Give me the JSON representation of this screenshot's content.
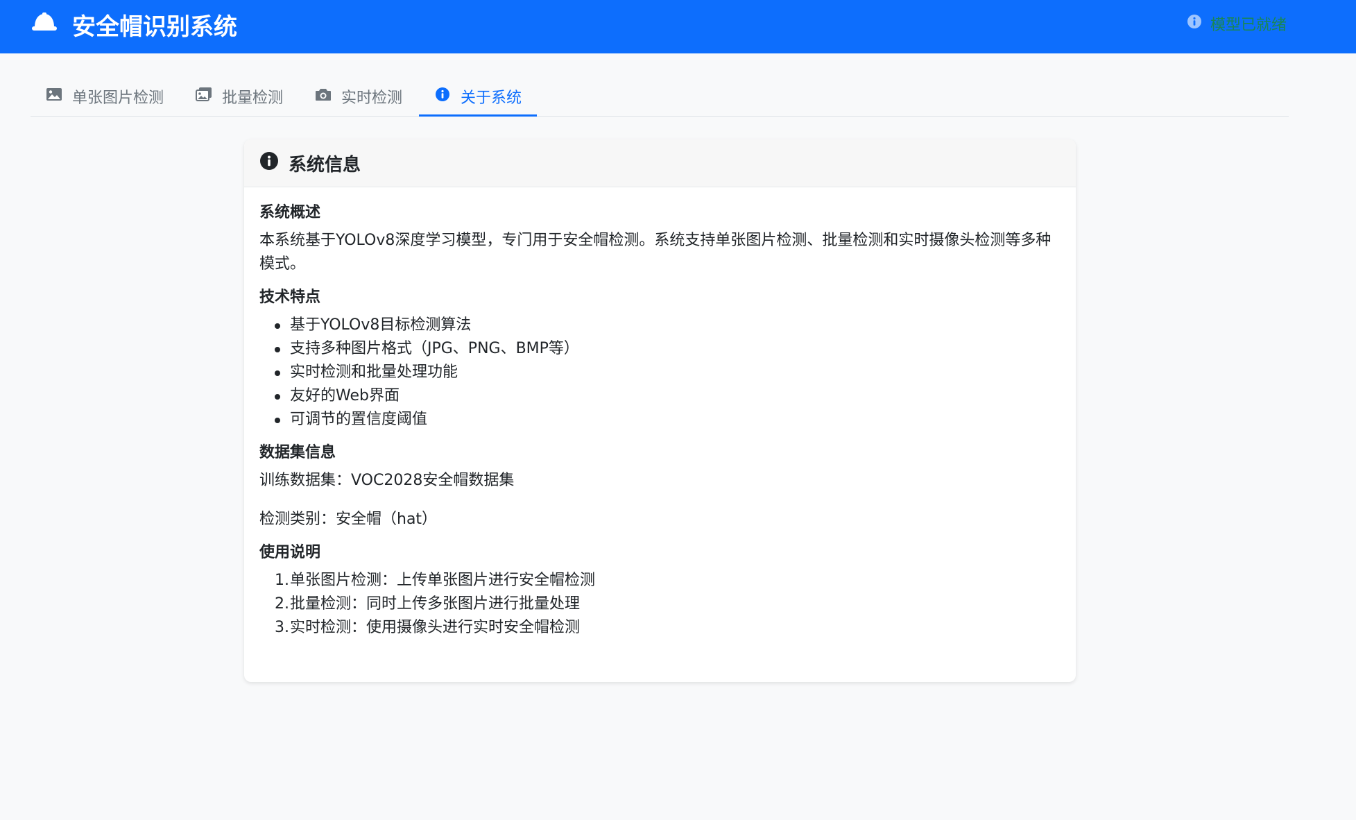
{
  "app": {
    "title": "安全帽识别系统",
    "status": "模型已就绪",
    "colors": {
      "primary": "#0d6efd",
      "success": "#198754"
    }
  },
  "tabs": [
    {
      "label": "单张图片检测",
      "icon": "image-icon"
    },
    {
      "label": "批量检测",
      "icon": "images-icon"
    },
    {
      "label": "实时检测",
      "icon": "camera-icon"
    },
    {
      "label": "关于系统",
      "icon": "info-circle-icon",
      "active": true
    }
  ],
  "card": {
    "title": "系统信息",
    "overview": {
      "heading": "系统概述",
      "text": "本系统基于YOLOv8深度学习模型，专门用于安全帽检测。系统支持单张图片检测、批量检测和实时摄像头检测等多种模式。"
    },
    "features": {
      "heading": "技术特点",
      "items": [
        "基于YOLOv8目标检测算法",
        "支持多种图片格式（JPG、PNG、BMP等）",
        "实时检测和批量处理功能",
        "友好的Web界面",
        "可调节的置信度阈值"
      ]
    },
    "dataset": {
      "heading": "数据集信息",
      "train": "训练数据集：VOC2028安全帽数据集",
      "classes": "检测类别：安全帽（hat）"
    },
    "usage": {
      "heading": "使用说明",
      "items": [
        "单张图片检测：上传单张图片进行安全帽检测",
        "批量检测：同时上传多张图片进行批量处理",
        "实时检测：使用摄像头进行实时安全帽检测"
      ]
    }
  }
}
